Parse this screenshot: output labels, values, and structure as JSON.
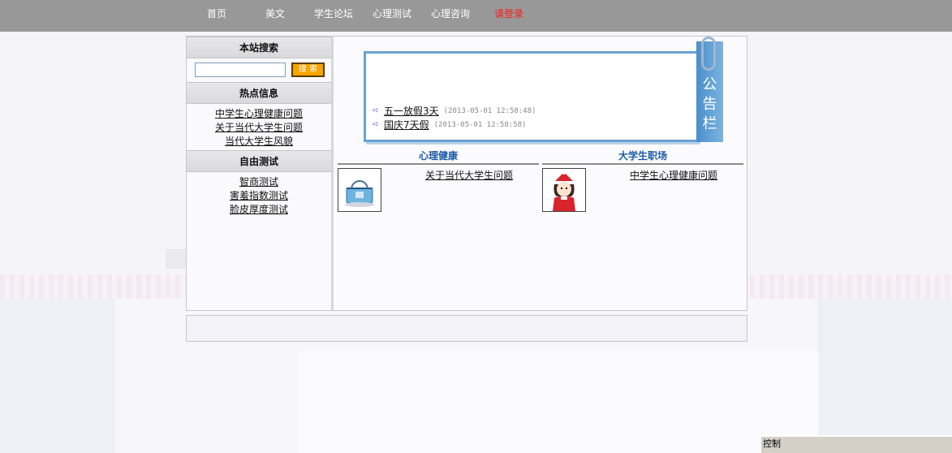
{
  "nav": {
    "items": [
      "首页",
      "美文",
      "学生论坛",
      "心理测试",
      "心理咨询"
    ],
    "login": "请登录"
  },
  "sidebar": {
    "search_title": "本站搜索",
    "search_button": "搜 索",
    "hot_title": "热点信息",
    "hot_items": [
      "中学生心理健康问题",
      "关于当代大学生问题",
      "当代大学生风貌"
    ],
    "test_title": "自由测试",
    "test_items": [
      "智商测试",
      "害羞指数测试",
      "脸皮厚度测试"
    ]
  },
  "notice": {
    "tab_label": [
      "公",
      "告",
      "栏"
    ],
    "items": [
      {
        "title": "五一放假3天",
        "date": "(2013-05-01 12:58:48)"
      },
      {
        "title": "国庆7天假",
        "date": "(2013-05-01 12:58:58)"
      }
    ]
  },
  "columns": [
    {
      "title": "心理健康",
      "link": "关于当代大学生问题",
      "icon": "basket-icon"
    },
    {
      "title": "大学生职场",
      "link": "中学生心理健康问题",
      "icon": "girl-avatar-icon"
    }
  ],
  "control": {
    "label": "控制"
  },
  "colors": {
    "topbar": "#989898",
    "login": "#ff1a1a",
    "column_title": "#1a5aa8",
    "search_button": "#f7a500"
  }
}
